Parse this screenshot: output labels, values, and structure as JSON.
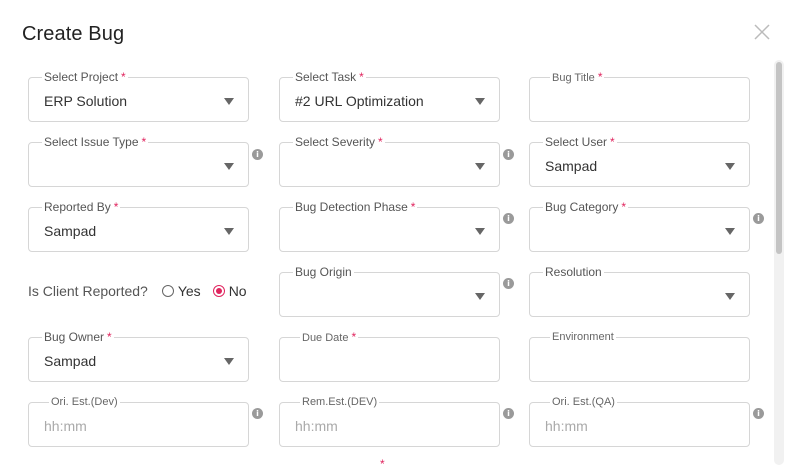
{
  "dialog": {
    "title": "Create Bug",
    "close_icon": "close-icon"
  },
  "fields": {
    "project": {
      "label": "Select Project",
      "required": "*",
      "value": "ERP Solution"
    },
    "task": {
      "label": "Select Task",
      "required": "*",
      "value": "#2 URL Optimization"
    },
    "bug_title": {
      "label": "Bug Title",
      "required": "*",
      "value": ""
    },
    "issue_type": {
      "label": "Select Issue Type",
      "required": "*",
      "value": ""
    },
    "severity": {
      "label": "Select Severity",
      "required": "*",
      "value": ""
    },
    "user": {
      "label": "Select User",
      "required": "*",
      "value": "Sampad"
    },
    "reported_by": {
      "label": "Reported By",
      "required": "*",
      "value": "Sampad"
    },
    "detection_phase": {
      "label": "Bug Detection Phase",
      "required": "*",
      "value": ""
    },
    "category": {
      "label": "Bug Category",
      "required": "*",
      "value": ""
    },
    "origin": {
      "label": "Bug Origin",
      "value": ""
    },
    "resolution": {
      "label": "Resolution",
      "value": ""
    },
    "owner": {
      "label": "Bug Owner",
      "required": "*",
      "value": "Sampad"
    },
    "due_date": {
      "label": "Due Date",
      "required": "*",
      "value": ""
    },
    "environment": {
      "label": "Environment",
      "value": ""
    },
    "ori_est_dev": {
      "label": "Ori. Est.(Dev)",
      "placeholder": "hh:mm"
    },
    "rem_est_dev": {
      "label": "Rem.Est.(DEV)",
      "placeholder": "hh:mm"
    },
    "ori_est_qa": {
      "label": "Ori. Est.(QA)",
      "placeholder": "hh:mm"
    }
  },
  "client_reported": {
    "label": "Is Client Reported?",
    "options": [
      "Yes",
      "No"
    ],
    "selected": "No"
  },
  "info_glyph": "i",
  "stray_required": "*",
  "colors": {
    "required": "#e0245e",
    "radio_selected": "#e0245e",
    "border": "#d6d6d6"
  }
}
